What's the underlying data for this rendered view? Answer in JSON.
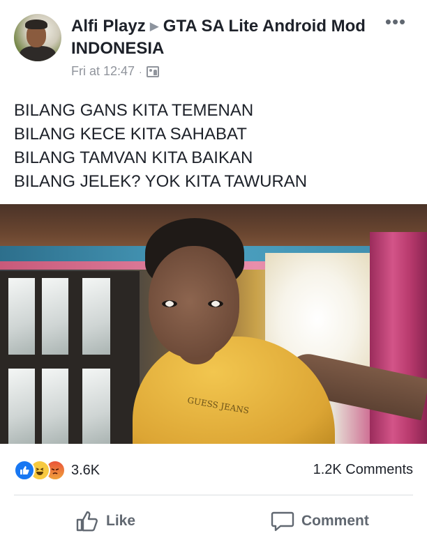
{
  "post": {
    "author": "Alfi Playz",
    "group": "GTA SA Lite Android Mod INDONESIA",
    "timestamp": "Fri at 12:47",
    "meta_separator": "·",
    "privacy_icon": "group-privacy-icon",
    "text_lines": [
      "BILANG GANS KITA TEMENAN",
      "BILANG KECE KITA SAHABAT",
      "BILANG TAMVAN KITA BAIKAN",
      "BILANG JELEK? YOK KITA TAWURAN"
    ],
    "photo_shirt_text": "GUESS JEANS"
  },
  "reactions": {
    "icons": [
      "like-icon",
      "haha-icon",
      "angry-icon"
    ],
    "count": "3.6K",
    "comments": "1.2K Comments"
  },
  "actions": {
    "like_label": "Like",
    "comment_label": "Comment"
  },
  "colors": {
    "text": "#1d2129",
    "muted": "#90949c",
    "like_blue": "#1877f2"
  }
}
